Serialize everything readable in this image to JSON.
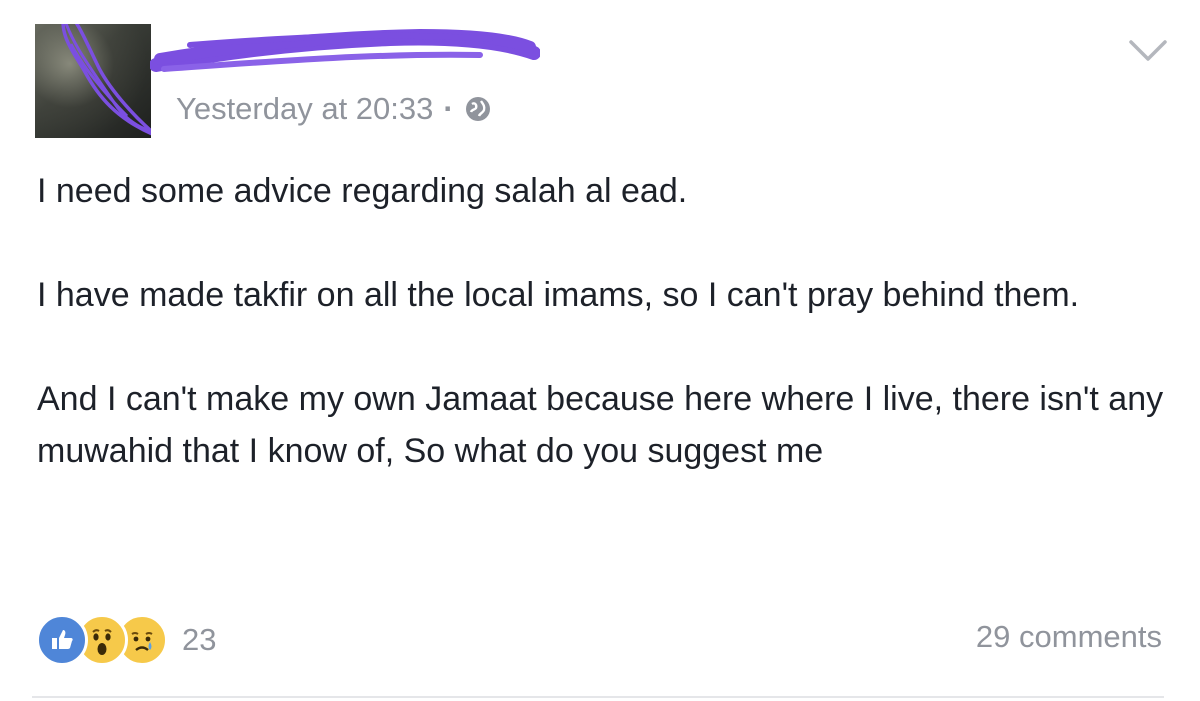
{
  "post": {
    "author_name_redacted": true,
    "timestamp": "Yesterday at 20:33",
    "separator": "·",
    "privacy_icon": "globe-icon",
    "options_icon": "chevron-down-icon",
    "paragraphs": [
      "I need some advice regarding salah al ead.",
      "I have made takfir on all the local imams, so I can't pray behind them.",
      "And I can't make my own Jamaat because here where I live, there isn't any muwahid that I know of, So what do you suggest me"
    ],
    "reactions": {
      "icons": [
        "like-icon",
        "wow-icon",
        "sad-icon"
      ],
      "count": "23"
    },
    "comments_label": "29 comments"
  },
  "colors": {
    "meta_gray": "#90949c",
    "text": "#1d2129",
    "like_blue": "#4f86d8",
    "emoji_yellow": "#f6c94a",
    "redaction_purple": "#7b4fe0"
  }
}
